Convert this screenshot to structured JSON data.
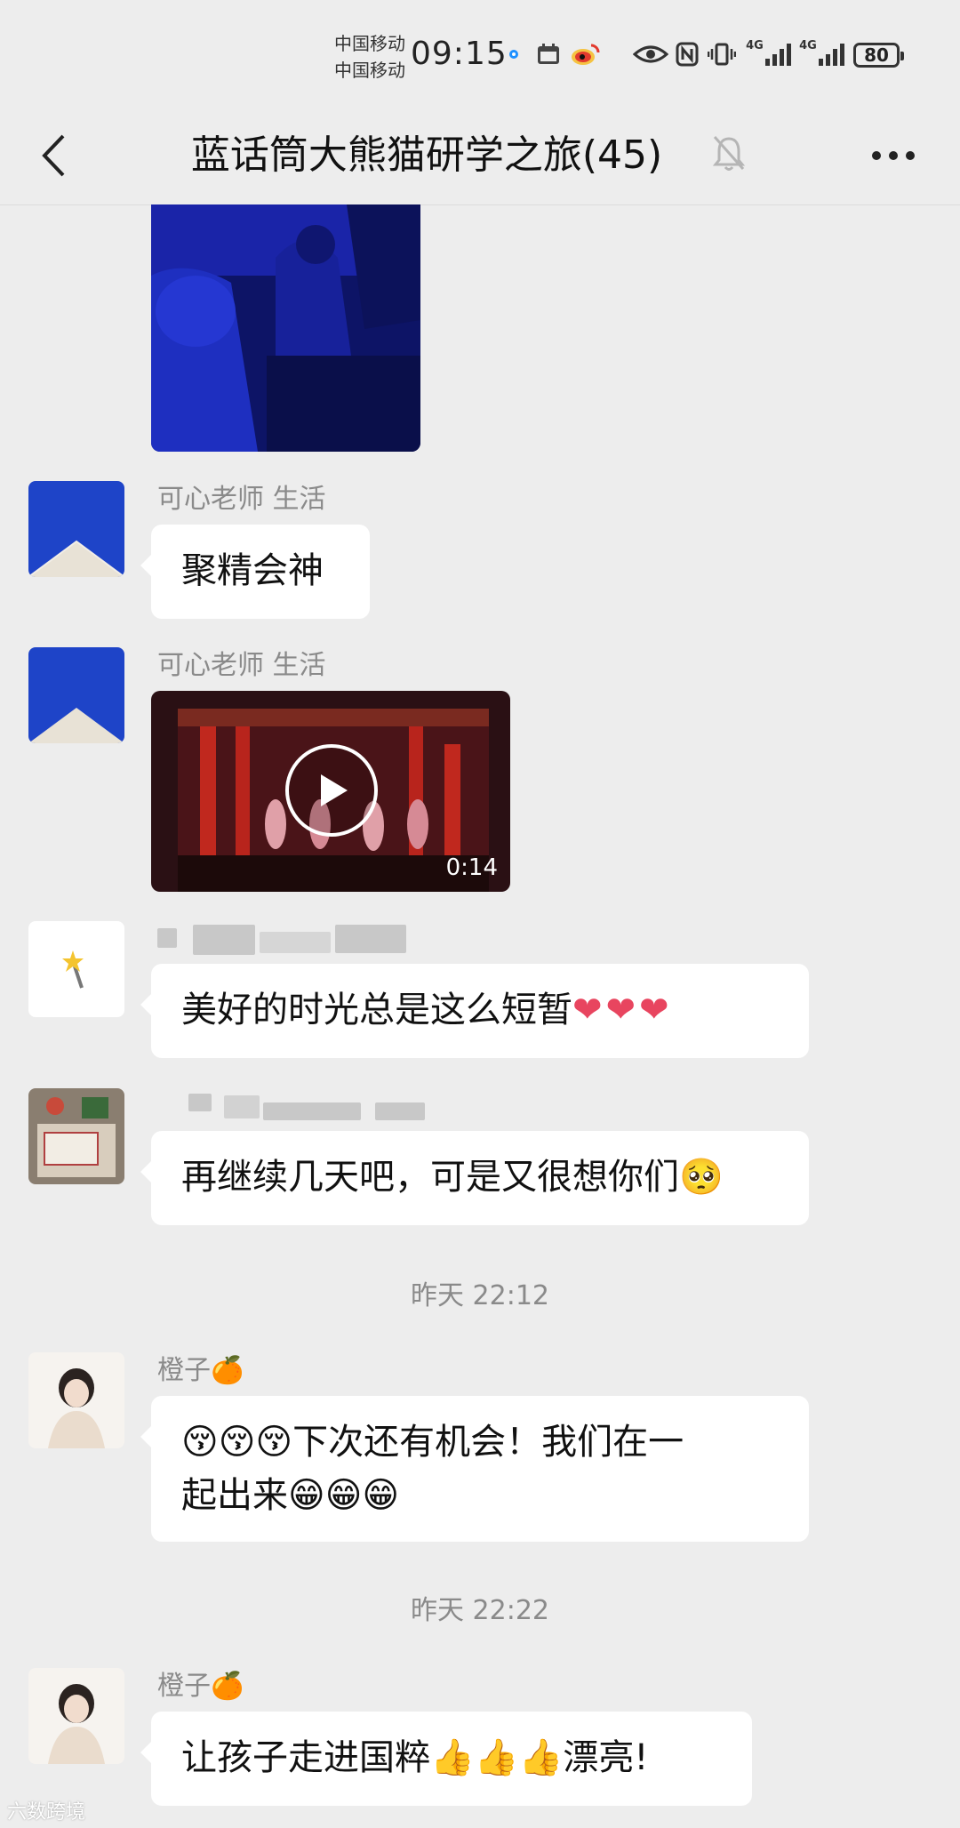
{
  "status_bar": {
    "carrier_1": "中国移动",
    "carrier_2": "中国移动",
    "time": "09:15",
    "network_1": "4G",
    "network_2": "4G",
    "battery": "80"
  },
  "header": {
    "title": "蓝话筒大熊猫研学之旅(45)",
    "back_icon": "chevron-left-icon",
    "mute_icon": "bell-off-icon",
    "more_icon": "more-horizontal-icon"
  },
  "messages": [
    {
      "type": "image",
      "description_icon": "photo"
    },
    {
      "sender": "可心老师 生活",
      "type": "text",
      "text": "聚精会神"
    },
    {
      "sender": "可心老师 生活",
      "type": "video",
      "duration": "0:14"
    },
    {
      "sender": "",
      "type": "text",
      "text": "美好的时光总是这么短暂",
      "emoji": "❤❤❤"
    },
    {
      "sender": "",
      "type": "text",
      "text": "再继续几天吧，可是又很想你们",
      "emoji": "🥺"
    },
    {
      "type": "timestamp",
      "text": "昨天 22:12"
    },
    {
      "sender": "橙子",
      "sender_emoji": "🍊",
      "type": "text",
      "line_1": "😚😚😚下次还有机会！我们在一",
      "line_2": "起出来😁😁😁"
    },
    {
      "type": "timestamp",
      "text": "昨天 22:22"
    },
    {
      "sender": "橙子",
      "sender_emoji": "🍊",
      "type": "text",
      "text": "让孩子走进国粹👍👍👍漂亮!"
    }
  ],
  "watermark": "六数跨境",
  "colors": {
    "background": "#ededed",
    "bubble": "#ffffff",
    "name_text": "#8a8a8a",
    "avatar_blue": "#1e44c8",
    "heart": "#e8455f"
  }
}
